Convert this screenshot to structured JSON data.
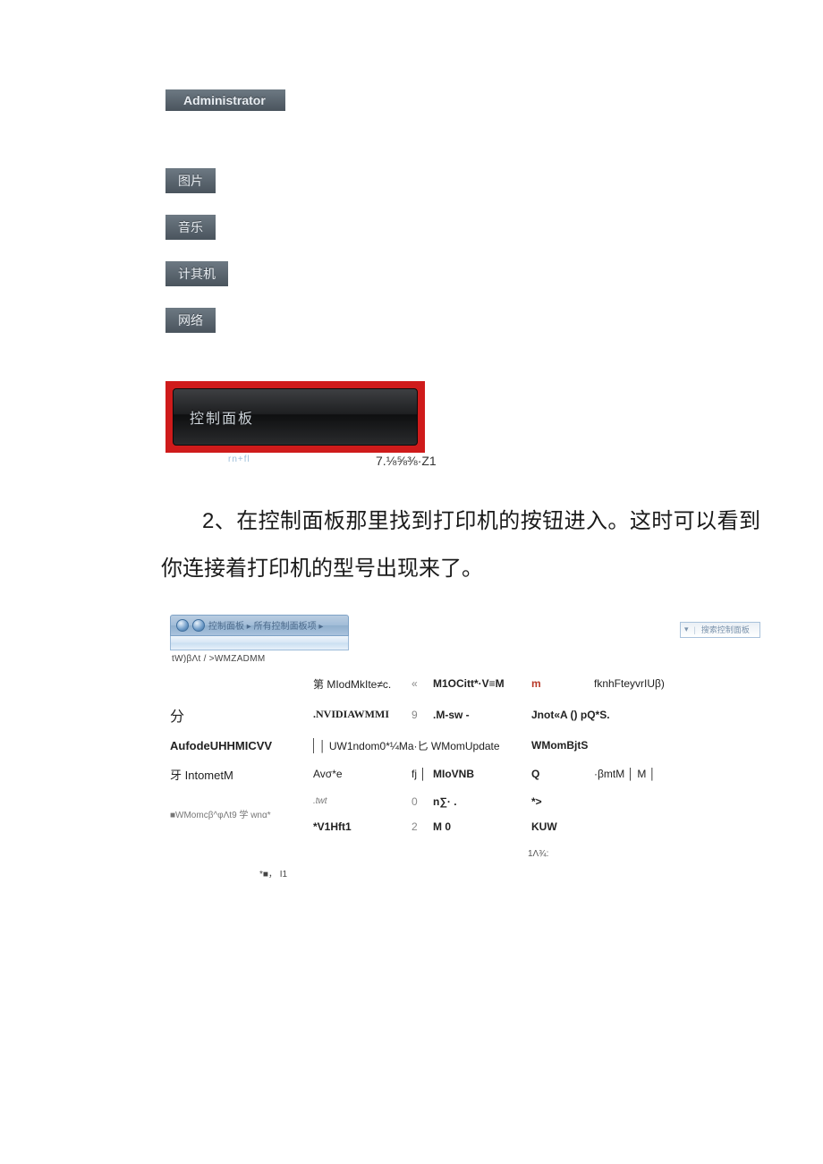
{
  "startMenu": {
    "admin": "Administrator",
    "items": [
      "图片",
      "音乐",
      "计其机",
      "网络"
    ],
    "controlPanel": "控制面板",
    "cpCaption": "rn+fl"
  },
  "figureCaption": "7.⅛⅝⅜·Z1",
  "paragraph": {
    "numPrefix": "2、",
    "text": "在控制面板那里找到打印机的按钮进入。这时可以看到你连接着打印机的型号出现来了。"
  },
  "cpWindow": {
    "breadcrumbText": "控制面板 ▸ 所有控制面板项 ▸",
    "searchHint": "搜索控制面板",
    "subline": "tW)βΛt / >WMZADMM",
    "side": {
      "r1": "分",
      "r2": "AufodeUHHMICVV",
      "r3": "牙 IntometM",
      "r4": "■WMomcβ^φΛt9 学 wnα*"
    },
    "gridRows": [
      {
        "c1": "第 MIodMkIte≠c.",
        "c2": "«",
        "c3": "M1OCitt*·V≡M",
        "c4": "m",
        "c5": "fknhFteyvrIUβ)"
      },
      {
        "c1": ".NVIDIAWMMI",
        "c2": "9",
        "c3": ".M-sw -",
        "c4": "Jnot«A () pQ*S.",
        "c5": ""
      },
      {
        "c1": "│ UW1ndom0*¼Ma·匕 WMomUpdate",
        "c2": "",
        "c3": "",
        "c4": "WMomBjtS",
        "c5": ""
      },
      {
        "c1": "Avσ*e",
        "c2": "fj │",
        "c3": "MIoVNB",
        "c4": "Q",
        "c5": "·βmtM │ M │"
      },
      {
        "c1": ".twt",
        "c2": "0",
        "c3": "n∑·    .",
        "c4": "*>",
        "c5": ""
      },
      {
        "c1": "*V1Hft1",
        "c2": "2",
        "c3": "M      0",
        "c4": "KUW",
        "c5": ""
      }
    ],
    "footer1": "1Λ¾:",
    "footer2": "*■，  I1"
  }
}
